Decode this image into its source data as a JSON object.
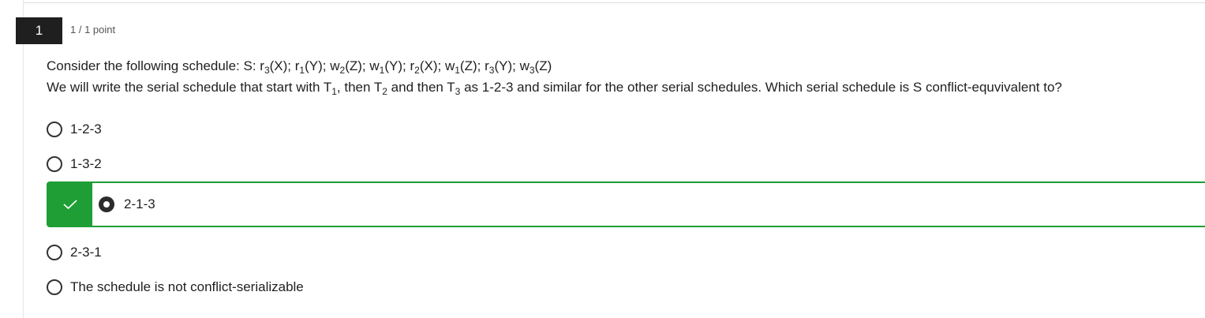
{
  "question": {
    "number": "1",
    "points": "1 / 1 point",
    "prompt_line1": {
      "lead": "Consider the following schedule: S: ",
      "ops": [
        {
          "op": "r",
          "sub": "3",
          "arg": "(X)",
          "sep": "; "
        },
        {
          "op": "r",
          "sub": "1",
          "arg": "(Y)",
          "sep": "; "
        },
        {
          "op": "w",
          "sub": "2",
          "arg": "(Z)",
          "sep": "; "
        },
        {
          "op": "w",
          "sub": "1",
          "arg": "(Y)",
          "sep": "; "
        },
        {
          "op": "r",
          "sub": "2",
          "arg": "(X)",
          "sep": "; "
        },
        {
          "op": "w",
          "sub": "1",
          "arg": "(Z)",
          "sep": "; "
        },
        {
          "op": "r",
          "sub": "3",
          "arg": "(Y)",
          "sep": "; "
        },
        {
          "op": "w",
          "sub": "3",
          "arg": "(Z)",
          "sep": ""
        }
      ]
    },
    "prompt_line2": {
      "a": "We will write the serial schedule that start with T",
      "a_sub": "1",
      "b": ", then T",
      "b_sub": "2",
      "c": " and then T",
      "c_sub": "3",
      "d": " as 1-2-3 and similar for the other serial schedules. Which serial schedule is S conflict-equvivalent to?"
    },
    "options": [
      {
        "label": "1-2-3",
        "selected": false
      },
      {
        "label": "1-3-2",
        "selected": false
      },
      {
        "label": "2-1-3",
        "selected": true,
        "correct": true
      },
      {
        "label": "2-3-1",
        "selected": false
      },
      {
        "label": "The schedule is not conflict-serializable",
        "selected": false
      }
    ]
  },
  "colors": {
    "correct": "#1f9e35",
    "qnum_bg": "#1f1f1f"
  },
  "icons": {
    "correct_mark": "check-icon"
  }
}
